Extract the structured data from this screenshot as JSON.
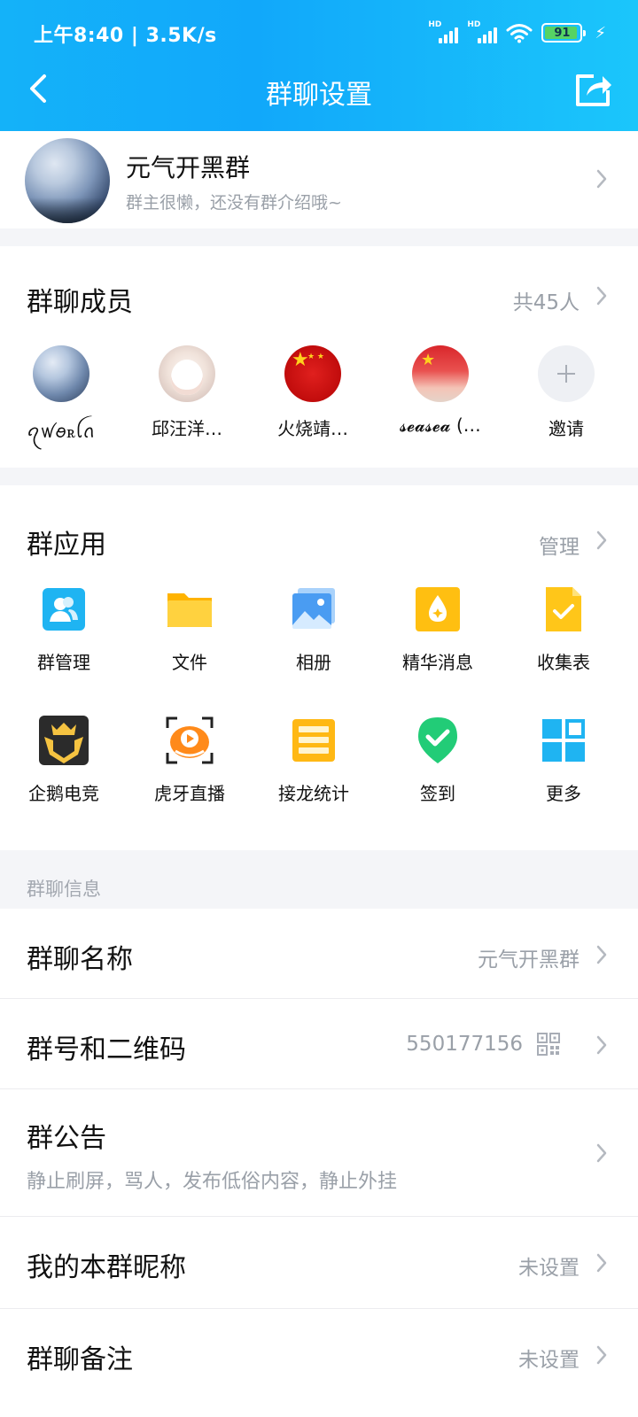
{
  "status_bar": {
    "time": "上午8:40 | 3.5K/s",
    "sim1": "HD",
    "sim2": "HD",
    "battery": "91"
  },
  "nav": {
    "title": "群聊设置",
    "back_icon": "chevron-left-icon",
    "share_icon": "share-icon"
  },
  "group": {
    "name": "元气开黑群",
    "intro": "群主很懒，还没有群介绍哦~"
  },
  "members": {
    "title": "群聊成员",
    "count": "共45人",
    "list": [
      {
        "name": "ꪖꪝꪮꭱꪶꪒ"
      },
      {
        "name": "邱汪洋…"
      },
      {
        "name": "火烧靖…"
      },
      {
        "name": "𝓼𝓮𝓪𝓼𝓮𝓪 (…"
      },
      {
        "name": "邀请"
      }
    ]
  },
  "apps": {
    "title": "群应用",
    "manage": "管理",
    "items": [
      {
        "label": "群管理",
        "icon": "group-manage-icon",
        "color": "#1fb4f2"
      },
      {
        "label": "文件",
        "icon": "folder-icon",
        "color": "#ffc619"
      },
      {
        "label": "相册",
        "icon": "photo-album-icon",
        "color": "#3d8ff0"
      },
      {
        "label": "精华消息",
        "icon": "essence-icon",
        "color": "#ffbf11"
      },
      {
        "label": "收集表",
        "icon": "form-collect-icon",
        "color": "#ffc619"
      },
      {
        "label": "企鹅电竞",
        "icon": "penguin-esports-icon",
        "color": "#2b2b2b"
      },
      {
        "label": "虎牙直播",
        "icon": "huya-live-icon",
        "color": "#ff8a1a"
      },
      {
        "label": "接龙统计",
        "icon": "chain-stats-icon",
        "color": "#ffb814"
      },
      {
        "label": "签到",
        "icon": "checkin-icon",
        "color": "#22cc77"
      },
      {
        "label": "更多",
        "icon": "more-grid-icon",
        "color": "#1fb4f2"
      }
    ]
  },
  "info": {
    "section_label": "群聊信息",
    "rows": [
      {
        "title": "群聊名称",
        "value": "元气开黑群"
      },
      {
        "title": "群号和二维码",
        "value": "550177156"
      },
      {
        "title": "群公告",
        "sub": "静止刷屏，骂人，发布低俗内容，静止外挂"
      },
      {
        "title": "我的本群昵称",
        "value": "未设置"
      },
      {
        "title": "群聊备注",
        "value": "未设置"
      }
    ]
  }
}
